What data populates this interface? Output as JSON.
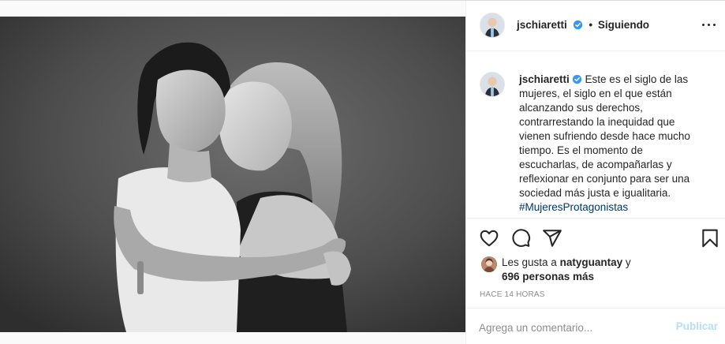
{
  "post": {
    "image_description": "",
    "author": {
      "username": "jschiaretti",
      "verified": true,
      "follow_status": "Siguiendo"
    },
    "more_icon": "more-horizontal-icon",
    "caption": {
      "username": "jschiaretti",
      "lines": [
        "Este es el siglo de las",
        "mujeres, el siglo en el que están",
        "alcanzando sus derechos,",
        "contrarrestando la inequidad que",
        "vienen sufriendo desde hace mucho",
        "tiempo. Es el momento de",
        "escucharlas, de acompañarlas y",
        "reflexionar en conjunto para ser una",
        "sociedad más justa e igualitaria."
      ],
      "hashtag": "#MujeresProtagonistas"
    },
    "actions": {
      "like_icon": "heart-icon",
      "comment_icon": "comment-icon",
      "share_icon": "send-icon",
      "save_icon": "bookmark-icon"
    },
    "likes": {
      "prefix": "Les gusta a",
      "liker": "naty­guantay",
      "connector": "y",
      "others": "696 personas más"
    },
    "timestamp": "Hace 14 horas",
    "comment": {
      "placeholder": "Agrega un comentario...",
      "publish_label": "Publicar"
    },
    "colors": {
      "verified": "#3897f0",
      "publish_disabled": "#b2dffc",
      "hashtag": "#00376b",
      "muted": "#8e8e8e"
    }
  }
}
